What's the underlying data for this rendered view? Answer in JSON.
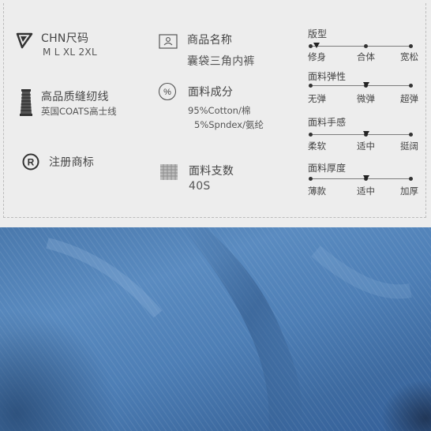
{
  "size": {
    "title": "CHN尺码",
    "sizes": "M L XL 2XL"
  },
  "thread": {
    "title": "高品质缝纫线",
    "desc": "英国COATS高士线"
  },
  "trademark": {
    "title": "注册商标"
  },
  "product": {
    "title": "商品名称",
    "value": "囊袋三角内裤"
  },
  "material": {
    "title": "面料成分",
    "line1": "95%Cotton/棉",
    "line2": "5%Spndex/氨纶"
  },
  "yarn": {
    "title": "面料支数",
    "value": "40S"
  },
  "scales": [
    {
      "title": "版型",
      "labels": [
        "修身",
        "合体",
        "宽松"
      ],
      "selected": "修身"
    },
    {
      "title": "面料弹性",
      "labels": [
        "无弹",
        "微弹",
        "超弹"
      ],
      "selected": "微弹"
    },
    {
      "title": "面料手感",
      "labels": [
        "柔软",
        "适中",
        "挺阔"
      ],
      "selected": "适中"
    },
    {
      "title": "面料厚度",
      "labels": [
        "薄款",
        "适中",
        "加厚"
      ],
      "selected": "适中"
    }
  ],
  "colors": {
    "fabric": "#4f81b8",
    "panel_bg": "#ededed",
    "text": "#444444"
  }
}
